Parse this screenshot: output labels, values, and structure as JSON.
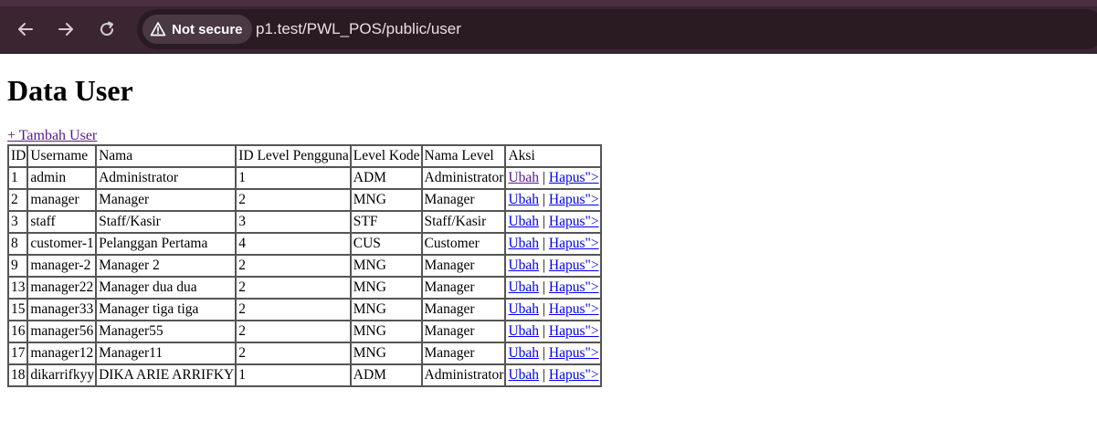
{
  "browser": {
    "security_label": "Not secure",
    "url": "p1.test/PWL_POS/public/user"
  },
  "page": {
    "title": "Data User",
    "add_link": "+ Tambah User"
  },
  "table": {
    "headers": [
      "ID",
      "Username",
      "Nama",
      "ID Level Pengguna",
      "Level Kode",
      "Nama Level",
      "Aksi"
    ],
    "rows": [
      {
        "id": "1",
        "username": "admin",
        "nama": "Administrator",
        "level_id": "1",
        "level_kode": "ADM",
        "level_nama": "Administrator"
      },
      {
        "id": "2",
        "username": "manager",
        "nama": "Manager",
        "level_id": "2",
        "level_kode": "MNG",
        "level_nama": "Manager"
      },
      {
        "id": "3",
        "username": "staff",
        "nama": "Staff/Kasir",
        "level_id": "3",
        "level_kode": "STF",
        "level_nama": "Staff/Kasir"
      },
      {
        "id": "8",
        "username": "customer-1",
        "nama": "Pelanggan Pertama",
        "level_id": "4",
        "level_kode": "CUS",
        "level_nama": "Customer"
      },
      {
        "id": "9",
        "username": "manager-2",
        "nama": "Manager 2",
        "level_id": "2",
        "level_kode": "MNG",
        "level_nama": "Manager"
      },
      {
        "id": "13",
        "username": "manager22",
        "nama": "Manager dua dua",
        "level_id": "2",
        "level_kode": "MNG",
        "level_nama": "Manager"
      },
      {
        "id": "15",
        "username": "manager33",
        "nama": "Manager tiga tiga",
        "level_id": "2",
        "level_kode": "MNG",
        "level_nama": "Manager"
      },
      {
        "id": "16",
        "username": "manager56",
        "nama": "Manager55",
        "level_id": "2",
        "level_kode": "MNG",
        "level_nama": "Manager"
      },
      {
        "id": "17",
        "username": "manager12",
        "nama": "Manager11",
        "level_id": "2",
        "level_kode": "MNG",
        "level_nama": "Manager"
      },
      {
        "id": "18",
        "username": "dikarrifkyy",
        "nama": "DIKA ARIE ARRIFKY",
        "level_id": "1",
        "level_kode": "ADM",
        "level_nama": "Administrator"
      }
    ],
    "action_edit": "Ubah",
    "action_separator": "|",
    "action_delete": "Hapus\">"
  }
}
